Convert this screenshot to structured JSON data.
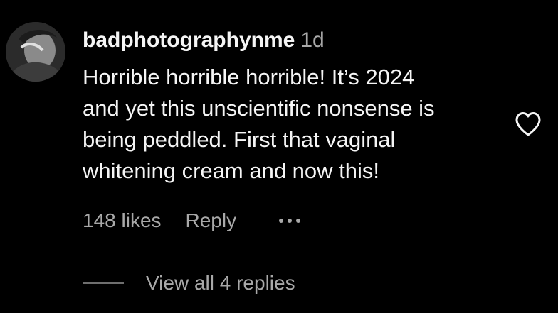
{
  "comment": {
    "username": "badphotographynme",
    "time": "1d",
    "text_lines": [
      "Horrible horrible horrible! It’s 2024",
      "and yet this unscientific nonsense is",
      "being peddled. First that vaginal",
      "whitening cream and now this!"
    ],
    "likes": "148 likes",
    "reply_label": "Reply",
    "like_icon": "heart-outline-icon",
    "more_icon": "ellipsis-icon"
  },
  "replies": {
    "view_all_label": "View all 4 replies"
  },
  "colors": {
    "background": "#000000",
    "primary_text": "#f5f5f5",
    "secondary_text": "#a8a8a8"
  }
}
